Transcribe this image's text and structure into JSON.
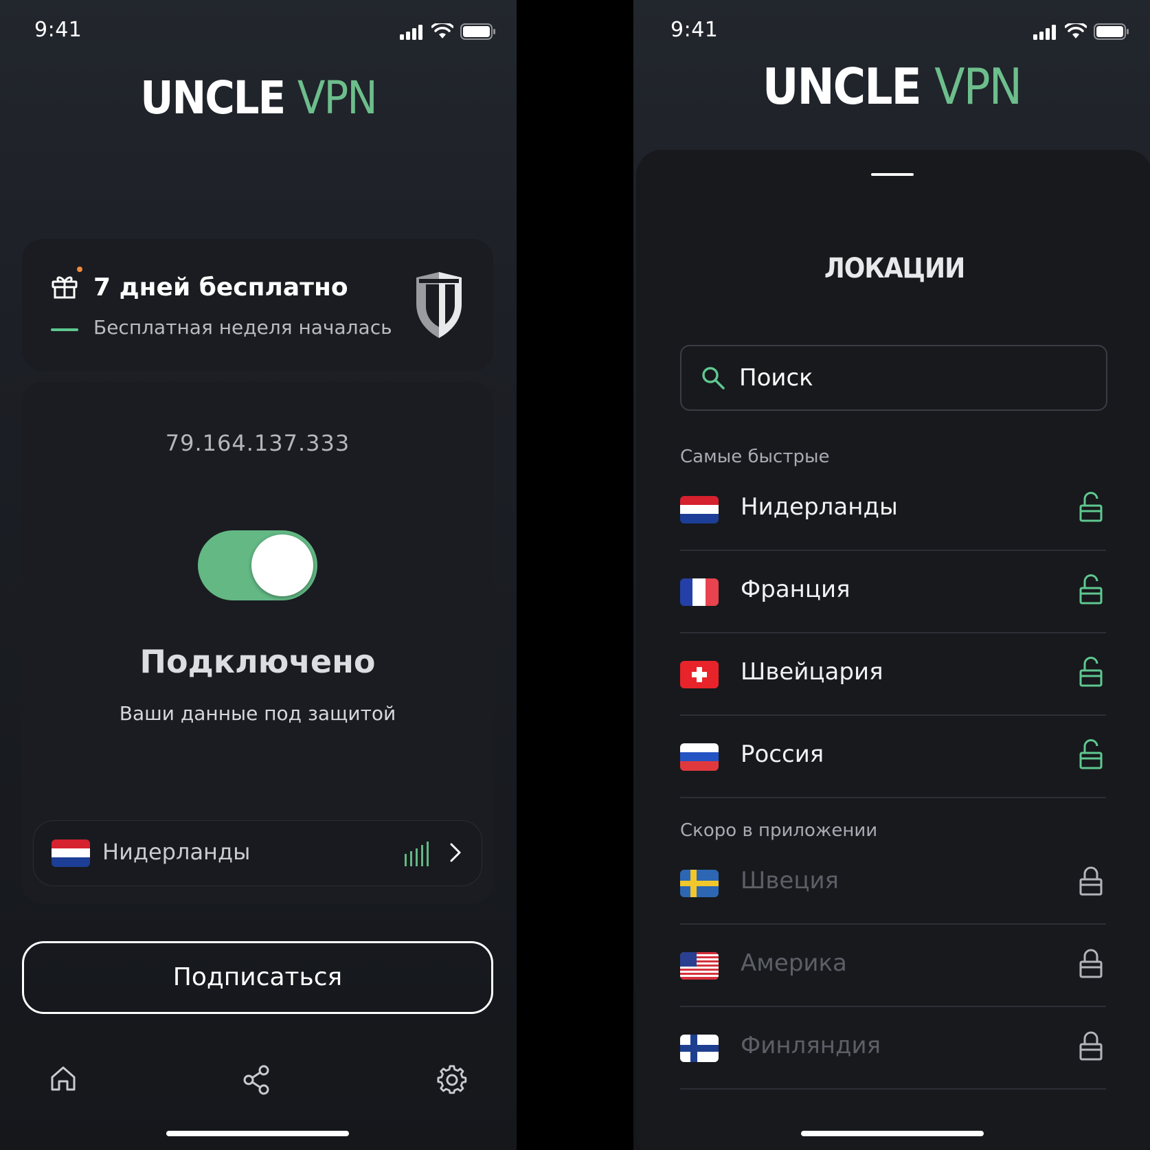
{
  "status": {
    "time": "9:41"
  },
  "app": {
    "logo_main": "UNCLE",
    "logo_accent": "VPN"
  },
  "trial": {
    "title": "7 дней бесплатно",
    "subtitle": "Бесплатная неделя началась"
  },
  "connection": {
    "ip": "79.164.137.333",
    "toggle_on": true,
    "state": "Подключено",
    "state_sub": "Ваши данные под защитой",
    "location": "Нидерланды"
  },
  "subscribe_label": "Подписаться",
  "tabs": [
    "home-icon",
    "share-icon",
    "gear-icon"
  ],
  "locations": {
    "title": "ЛОКАЦИИ",
    "search_placeholder": "Поиск",
    "fastest_label": "Самые быстрые",
    "fastest": [
      {
        "name": "Нидерланды",
        "flag": "nl"
      },
      {
        "name": "Франция",
        "flag": "fr"
      },
      {
        "name": "Швейцария",
        "flag": "ch"
      },
      {
        "name": "Россия",
        "flag": "ru"
      }
    ],
    "soon_label": "Скоро в приложении",
    "soon": [
      {
        "name": "Швеция",
        "flag": "se"
      },
      {
        "name": "Америка",
        "flag": "us"
      },
      {
        "name": "Финляндия",
        "flag": "fi"
      }
    ]
  },
  "colors": {
    "accent": "#63b884",
    "background": "#1c1f25",
    "card": "#1a1c21",
    "dot": "#f08a3c"
  }
}
